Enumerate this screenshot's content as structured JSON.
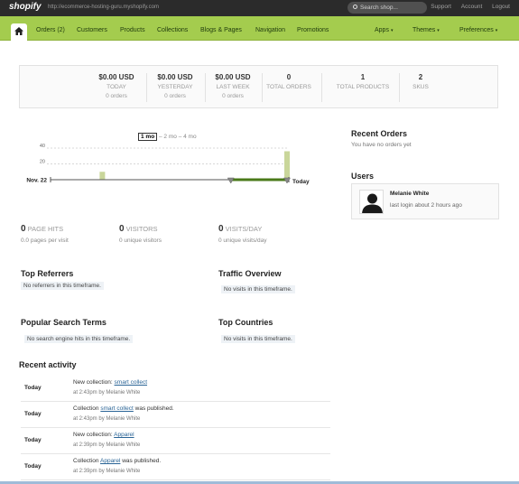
{
  "topbar": {
    "logo": "shopify",
    "shop_url": "http://ecommerce-hosting-guru.myshopify.com",
    "search_placeholder": "Search shop...",
    "links": [
      "Support",
      "Account",
      "Logout"
    ]
  },
  "nav": {
    "items": [
      "Orders (2)",
      "Customers",
      "Products",
      "Collections",
      "Blogs & Pages",
      "Navigation",
      "Promotions"
    ],
    "right_items": [
      "Apps",
      "Themes",
      "Preferences"
    ],
    "caret": "▾"
  },
  "stats": [
    {
      "value": "$0.00 USD",
      "label": "TODAY",
      "sub": "0 orders"
    },
    {
      "value": "$0.00 USD",
      "label": "YESTERDAY",
      "sub": "0 orders"
    },
    {
      "value": "$0.00 USD",
      "label": "LAST WEEK",
      "sub": "0 orders"
    },
    {
      "value": "0",
      "label": "TOTAL ORDERS",
      "sub": ""
    },
    {
      "value": "1",
      "label": "TOTAL PRODUCTS",
      "sub": ""
    },
    {
      "value": "2",
      "label": "SKUS",
      "sub": ""
    }
  ],
  "timeframe": {
    "current": "1 mo",
    "others": [
      "2 mo",
      "4 mo"
    ],
    "sep": "–"
  },
  "chart_data": {
    "type": "bar",
    "start_label": "Nov. 22",
    "end_label": "Today",
    "y_ticks": [
      20,
      40
    ],
    "ylim": [
      0,
      40
    ],
    "bars": [
      {
        "day": 6,
        "value": 10
      },
      {
        "day": 29,
        "value": 36
      }
    ],
    "days": 29,
    "range_start_day": 22,
    "grid": true
  },
  "traffic": [
    {
      "value": "0",
      "label": "PAGE HITS",
      "sub": "0.0 pages per visit"
    },
    {
      "value": "0",
      "label": "VISITORS",
      "sub": "0 unique visitors"
    },
    {
      "value": "0",
      "label": "VISITS/DAY",
      "sub": "0 unique visits/day"
    }
  ],
  "sections": {
    "top_referrers": {
      "title": "Top Referrers",
      "note": "No referrers in this timeframe."
    },
    "traffic_overview": {
      "title": "Traffic Overview",
      "note": "No visits in this timeframe."
    },
    "popular_search": {
      "title": "Popular Search Terms",
      "note": "No search engine hits in this timeframe."
    },
    "top_countries": {
      "title": "Top Countries",
      "note": "No visits in this timeframe."
    }
  },
  "activity": {
    "title": "Recent activity",
    "rows": [
      {
        "date": "Today",
        "pre": "New collection: ",
        "link": "smart collect",
        "post": "",
        "meta": "at 2:43pm by Melanie White"
      },
      {
        "date": "Today",
        "pre": "Collection ",
        "link": "smart collect",
        "post": " was published.",
        "meta": "at 2:43pm by Melanie White"
      },
      {
        "date": "Today",
        "pre": "New collection: ",
        "link": "Apparel",
        "post": "",
        "meta": "at 2:39pm by Melanie White"
      },
      {
        "date": "Today",
        "pre": "Collection ",
        "link": "Apparel",
        "post": " was published.",
        "meta": "at 2:39pm by Melanie White"
      }
    ]
  },
  "recent_orders": {
    "title": "Recent Orders",
    "note": "You have no orders yet"
  },
  "users": {
    "title": "Users",
    "name": "Melanie White",
    "last_login": "last login about 2 hours ago"
  },
  "colors": {
    "nav": "#a4cc4e",
    "topbar": "#2b2b2b",
    "bar": "#c9d69a",
    "range": "#4a7a1a"
  }
}
